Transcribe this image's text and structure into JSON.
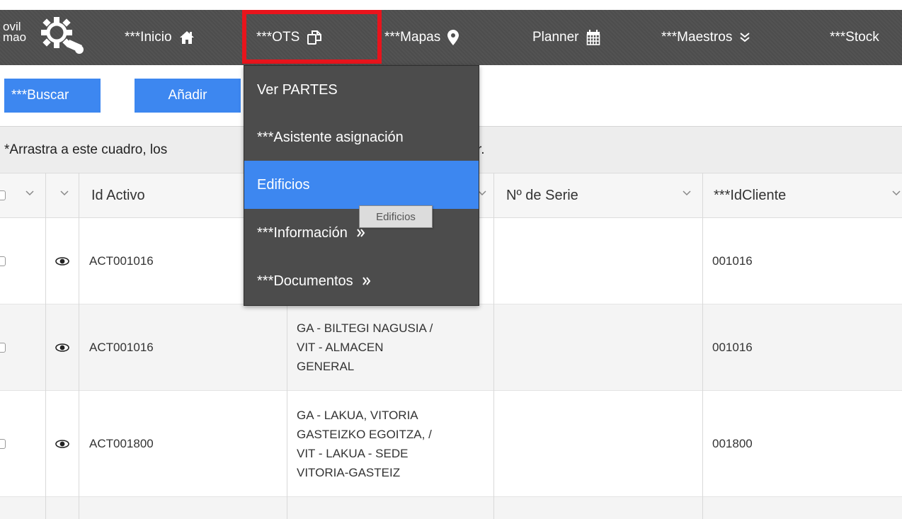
{
  "brand": {
    "line1": "ovil",
    "line2": "mao"
  },
  "nav": {
    "inicio": "***Inicio",
    "ots": "***OTS",
    "mapas": "***Mapas",
    "planner": "Planner",
    "maestros": "***Maestros",
    "stock": "***Stock"
  },
  "nav_icons": [
    "home-icon",
    "copy-icon",
    "map-marker-icon",
    "calendar-icon",
    "double-chevron-down-icon"
  ],
  "toolbar": {
    "buscar": "***Buscar",
    "anadir": "Añadir"
  },
  "group_panel": {
    "text_left": "*Arrastra a este cuadro, los",
    "text_tail": "r."
  },
  "grid": {
    "columns": [
      "Id Activo",
      "Nº de Serie",
      "***IdCliente"
    ],
    "rows": [
      {
        "id_activo": "ACT001016",
        "ubicacion": "",
        "serie": "",
        "id_cliente": "001016"
      },
      {
        "id_activo": "ACT001016",
        "ubicacion": "GA - BILTEGI NAGUSIA /\nVIT - ALMACEN\nGENERAL",
        "serie": "",
        "id_cliente": "001016"
      },
      {
        "id_activo": "ACT001800",
        "ubicacion": "GA - LAKUA, VITORIA\nGASTEIZKO EGOITZA, /\nVIT - LAKUA - SEDE\nVITORIA-GASTEIZ",
        "serie": "",
        "id_cliente": "001800"
      }
    ]
  },
  "dropdown": {
    "items": [
      {
        "label": "Ver PARTES",
        "active": false,
        "submenu": false
      },
      {
        "label": "***Asistente asignación",
        "active": false,
        "submenu": false
      },
      {
        "label": "Edificios",
        "active": true,
        "submenu": false
      },
      {
        "label": "***Información",
        "active": false,
        "submenu": true
      },
      {
        "label": "***Documentos",
        "active": false,
        "submenu": true
      }
    ]
  },
  "tooltip": "Edificios",
  "colors": {
    "navbar": "#4d4d4d",
    "accent": "#3d87f0",
    "highlight": "#e8141c",
    "dropdown": "#4c4c4c"
  }
}
